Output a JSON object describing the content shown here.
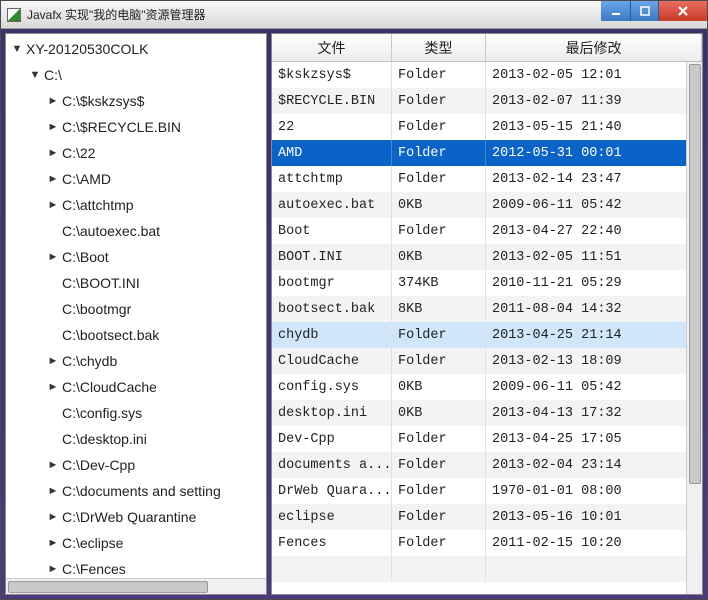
{
  "window": {
    "title": "Javafx 实现\"我的电脑\"资源管理器"
  },
  "tree": {
    "root": "XY-20120530COLK",
    "drive": "C:\\",
    "items": [
      {
        "label": "C:\\$kskzsys$",
        "expandable": true
      },
      {
        "label": "C:\\$RECYCLE.BIN",
        "expandable": true
      },
      {
        "label": "C:\\22",
        "expandable": true
      },
      {
        "label": "C:\\AMD",
        "expandable": true
      },
      {
        "label": "C:\\attchtmp",
        "expandable": true
      },
      {
        "label": "C:\\autoexec.bat",
        "expandable": false
      },
      {
        "label": "C:\\Boot",
        "expandable": true
      },
      {
        "label": "C:\\BOOT.INI",
        "expandable": false
      },
      {
        "label": "C:\\bootmgr",
        "expandable": false
      },
      {
        "label": "C:\\bootsect.bak",
        "expandable": false
      },
      {
        "label": "C:\\chydb",
        "expandable": true
      },
      {
        "label": "C:\\CloudCache",
        "expandable": true
      },
      {
        "label": "C:\\config.sys",
        "expandable": false
      },
      {
        "label": "C:\\desktop.ini",
        "expandable": false
      },
      {
        "label": "C:\\Dev-Cpp",
        "expandable": true
      },
      {
        "label": "C:\\documents and setting",
        "expandable": true
      },
      {
        "label": "C:\\DrWeb Quarantine",
        "expandable": true
      },
      {
        "label": "C:\\eclipse",
        "expandable": true
      },
      {
        "label": "C:\\Fences",
        "expandable": true
      }
    ]
  },
  "table": {
    "columns": [
      "文件",
      "类型",
      "最后修改"
    ],
    "selected_index": 3,
    "hover_index": 10,
    "rows": [
      {
        "name": "$kskzsys$",
        "type": "Folder",
        "modified": "2013-02-05 12:01"
      },
      {
        "name": "$RECYCLE.BIN",
        "type": "Folder",
        "modified": "2013-02-07 11:39"
      },
      {
        "name": "22",
        "type": "Folder",
        "modified": "2013-05-15 21:40"
      },
      {
        "name": "AMD",
        "type": "Folder",
        "modified": "2012-05-31 00:01"
      },
      {
        "name": "attchtmp",
        "type": "Folder",
        "modified": "2013-02-14 23:47"
      },
      {
        "name": "autoexec.bat",
        "type": "0KB",
        "modified": "2009-06-11 05:42"
      },
      {
        "name": "Boot",
        "type": "Folder",
        "modified": "2013-04-27 22:40"
      },
      {
        "name": "BOOT.INI",
        "type": "0KB",
        "modified": "2013-02-05 11:51"
      },
      {
        "name": "bootmgr",
        "type": "374KB",
        "modified": "2010-11-21 05:29"
      },
      {
        "name": "bootsect.bak",
        "type": "8KB",
        "modified": "2011-08-04 14:32"
      },
      {
        "name": "chydb",
        "type": "Folder",
        "modified": "2013-04-25 21:14"
      },
      {
        "name": "CloudCache",
        "type": "Folder",
        "modified": "2013-02-13 18:09"
      },
      {
        "name": "config.sys",
        "type": "0KB",
        "modified": "2009-06-11 05:42"
      },
      {
        "name": "desktop.ini",
        "type": "0KB",
        "modified": "2013-04-13 17:32"
      },
      {
        "name": "Dev-Cpp",
        "type": "Folder",
        "modified": "2013-04-25 17:05"
      },
      {
        "name": "documents a...",
        "type": "Folder",
        "modified": "2013-02-04 23:14"
      },
      {
        "name": "DrWeb Quara...",
        "type": "Folder",
        "modified": "1970-01-01 08:00"
      },
      {
        "name": "eclipse",
        "type": "Folder",
        "modified": "2013-05-16 10:01"
      },
      {
        "name": "Fences",
        "type": "Folder",
        "modified": "2011-02-15 10:20"
      }
    ]
  }
}
